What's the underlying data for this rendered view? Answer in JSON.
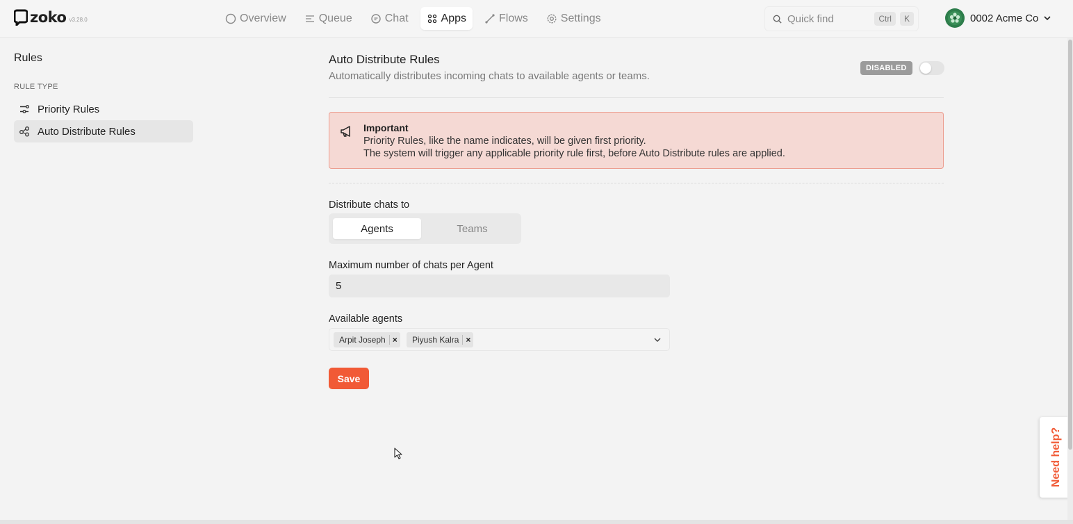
{
  "app": {
    "name": "zoko",
    "version": "v3.28.0"
  },
  "nav": {
    "items": [
      {
        "label": "Overview",
        "icon": "circle-icon"
      },
      {
        "label": "Queue",
        "icon": "list-icon"
      },
      {
        "label": "Chat",
        "icon": "chat-icon"
      },
      {
        "label": "Apps",
        "icon": "apps-grid-icon",
        "active": true
      },
      {
        "label": "Flows",
        "icon": "flows-icon"
      },
      {
        "label": "Settings",
        "icon": "gear-icon"
      }
    ]
  },
  "search": {
    "placeholder": "Quick find",
    "shortcut_ctrl": "Ctrl",
    "shortcut_key": "K"
  },
  "account": {
    "name": "0002 Acme Co"
  },
  "sidebar": {
    "title": "Rules",
    "section": "RULE TYPE",
    "items": [
      {
        "label": "Priority Rules",
        "icon": "sliders-icon"
      },
      {
        "label": "Auto Distribute Rules",
        "icon": "share-nodes-icon",
        "active": true
      }
    ]
  },
  "main": {
    "title": "Auto Distribute Rules",
    "subtitle": "Automatically distributes incoming chats to available agents or teams.",
    "status": "DISABLED",
    "alert": {
      "title": "Important",
      "line1": "Priority Rules, like the name indicates, will be given first priority.",
      "line2": "The system will trigger any applicable priority rule first, before Auto Distribute rules are applied."
    },
    "distribute_label": "Distribute chats to",
    "distribute_options": [
      "Agents",
      "Teams"
    ],
    "distribute_selected": "Agents",
    "max_chats_label": "Maximum number of chats per Agent",
    "max_chats_value": "5",
    "agents_label": "Available agents",
    "agents": [
      "Arpit Joseph",
      "Piyush Kalra"
    ],
    "save_label": "Save"
  },
  "help": {
    "label": "Need help?"
  },
  "colors": {
    "accent": "#f15a36",
    "alert_bg": "#f5d9d4",
    "alert_border": "#ec9e90"
  }
}
